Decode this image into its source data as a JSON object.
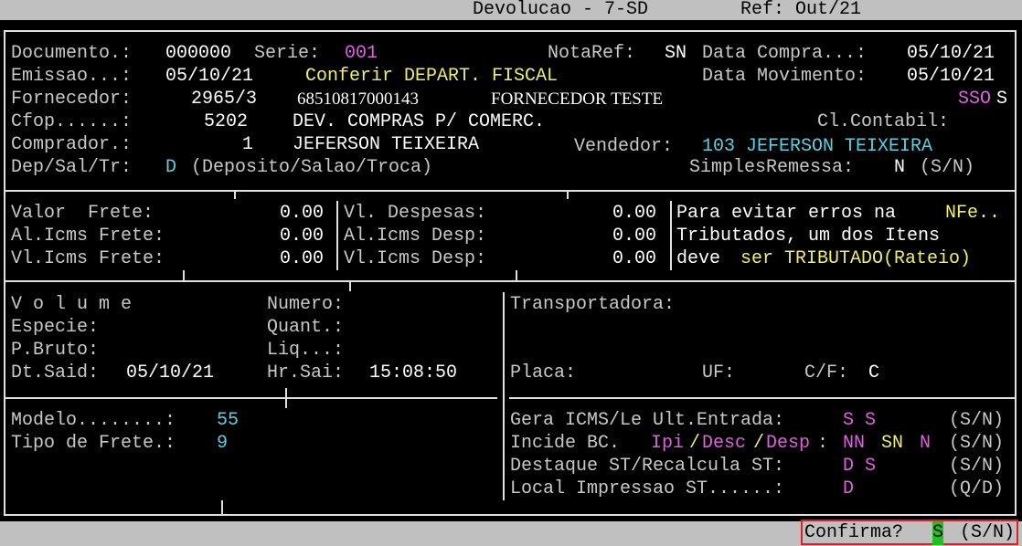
{
  "header": {
    "title": "Devolucao - 7-SD",
    "ref": "Ref: Out/21"
  },
  "doc": {
    "documento_label": "Documento.:",
    "documento": "000000",
    "serie_label": "Serie:",
    "serie": "001",
    "notaref_label": "NotaRef:",
    "notaref": "SN",
    "data_compra_label": "Data Compra...:",
    "data_compra": "05/10/21",
    "emissao_label": "Emissao...:",
    "emissao": "05/10/21",
    "conferir": "Conferir DEPART. FISCAL",
    "data_mov_label": "Data Movimento:",
    "data_mov": "05/10/21",
    "fornecedor_label": "Fornecedor:",
    "fornecedor_code": "2965/3",
    "cnpj": "68510817000143",
    "fornecedor_name": "FORNECEDOR TESTE",
    "ssos_a": "SSO",
    "ssos_b": "S",
    "cfop_label": "Cfop......:",
    "cfop": "5202",
    "cfop_desc": "DEV. COMPRAS P/ COMERC.",
    "cl_contabil_label": "Cl.Contabil:",
    "comprador_label": "Comprador.:",
    "comprador_code": "1",
    "comprador_name": "JEFERSON TEIXEIRA",
    "vendedor_label": "Vendedor:",
    "vendedor": "103 JEFERSON TEIXEIRA",
    "dep_label": "Dep/Sal/Tr:",
    "dep_value": "D",
    "dep_desc": "(Deposito/Salao/Troca)",
    "simples_label": "SimplesRemessa:",
    "simples_value": "N",
    "simples_opts": "(S/N)"
  },
  "valores": {
    "valor_frete_label": "Valor  Frete:",
    "valor_frete": "0.00",
    "al_icms_frete_label": "Al.Icms Frete:",
    "al_icms_frete": "0.00",
    "vl_icms_frete_label": "Vl.Icms Frete:",
    "vl_icms_frete": "0.00",
    "vl_despesas_label": "Vl. Despesas:",
    "vl_despesas": "0.00",
    "al_icms_desp_label": "Al.Icms Desp:",
    "al_icms_desp": "0.00",
    "vl_icms_desp_label": "Vl.Icms Desp:",
    "vl_icms_desp": "0.00",
    "note1_a": "Para evitar erros na ",
    "note1_b": "NFe..",
    "note2": "Tributados, um dos Itens",
    "note3_a": "deve ",
    "note3_b": "ser TRIBUTADO(Rateio)"
  },
  "volume": {
    "volume_label": "V o l u m e",
    "numero_label": "Numero:",
    "especie_label": "Especie:",
    "quant_label": "Quant.:",
    "pbruto_label": "P.Bruto:",
    "liq_label": "Liq...:",
    "dtsaid_label": "Dt.Said:",
    "dtsaid": "05/10/21",
    "hrsai_label": "Hr.Sai:",
    "hrsai": "15:08:50"
  },
  "transp": {
    "label": "Transportadora:",
    "placa_label": "Placa:",
    "uf_label": "UF:",
    "cf_label": "C/F:",
    "cf": "C"
  },
  "modelo": {
    "modelo_label": "Modelo........:",
    "modelo": "55",
    "frete_label": "Tipo de Frete.:",
    "frete": "9"
  },
  "icms": {
    "gera_label": "Gera ICMS/Le Ult.Entrada:",
    "gera_value": "S S",
    "gera_opts": "(S/N)",
    "incide_label": "Incide BC.",
    "ipi": "Ipi",
    "slash1": "/",
    "desc": "Desc",
    "slash2": "/",
    "desp": "Desp",
    "colon": ":",
    "incide_v1": "NN",
    "incide_v2": "SN",
    "incide_v3": "N",
    "incide_opts": "(S/N)",
    "destaque_label": "Destaque ST/Recalcula ST:",
    "destaque_value": "D S",
    "destaque_opts": "(S/N)",
    "local_label": "Local Impressao ST......:",
    "local_value": "D",
    "local_opts": "(Q/D)"
  },
  "footer": {
    "confirma_label": "Confirma?",
    "confirma_value": "S",
    "confirma_opts": "(S/N)"
  }
}
